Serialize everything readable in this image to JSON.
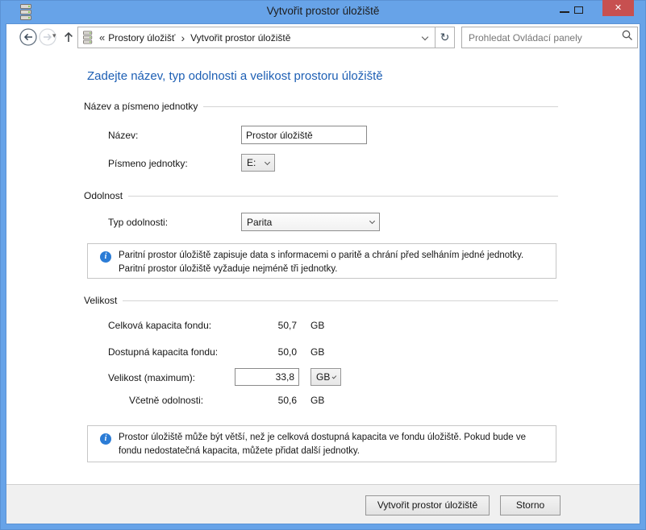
{
  "window": {
    "title": "Vytvořit prostor úložiště"
  },
  "glyphs": {
    "close": "✕",
    "overflow": "«",
    "separator": "›",
    "refresh": "↻",
    "dropdown_small": "▾",
    "info": "i"
  },
  "navbar": {
    "breadcrumb_item1": "Prostory úložišť",
    "breadcrumb_item2": "Vytvořit prostor úložiště",
    "search_placeholder": "Prohledat Ovládací panely"
  },
  "main": {
    "heading": "Zadejte název, typ odolnosti a velikost prostoru úložiště",
    "name_section": {
      "title": "Název a písmeno jednotky",
      "name_label": "Název:",
      "name_value": "Prostor úložiště",
      "drive_label": "Písmeno jednotky:",
      "drive_value": "E:"
    },
    "resiliency_section": {
      "title": "Odolnost",
      "type_label": "Typ odolnosti:",
      "type_value": "Parita",
      "info": "Paritní prostor úložiště zapisuje data s informacemi o paritě a chrání před selháním jedné jednotky.\nParitní prostor úložiště vyžaduje nejméně tři jednotky."
    },
    "size_section": {
      "title": "Velikost",
      "total_label": "Celková kapacita fondu:",
      "total_value": "50,7",
      "total_unit": "GB",
      "available_label": "Dostupná kapacita fondu:",
      "available_value": "50,0",
      "available_unit": "GB",
      "max_label": "Velikost (maximum):",
      "max_value": "33,8",
      "max_unit": "GB",
      "incl_label": "Včetně odolnosti:",
      "incl_value": "50,6",
      "incl_unit": "GB",
      "info": "Prostor úložiště může být větší, než je celková dostupná kapacita ve fondu úložiště. Pokud bude ve\nfondu nedostatečná kapacita, můžete přidat další jednotky."
    }
  },
  "footer": {
    "create_label": "Vytvořit prostor úložiště",
    "cancel_label": "Storno"
  },
  "colors": {
    "titlebar_blue": "#67a3e8",
    "close_red": "#c75050",
    "heading_blue": "#1d5fb4",
    "info_blue": "#2b7cd6"
  }
}
